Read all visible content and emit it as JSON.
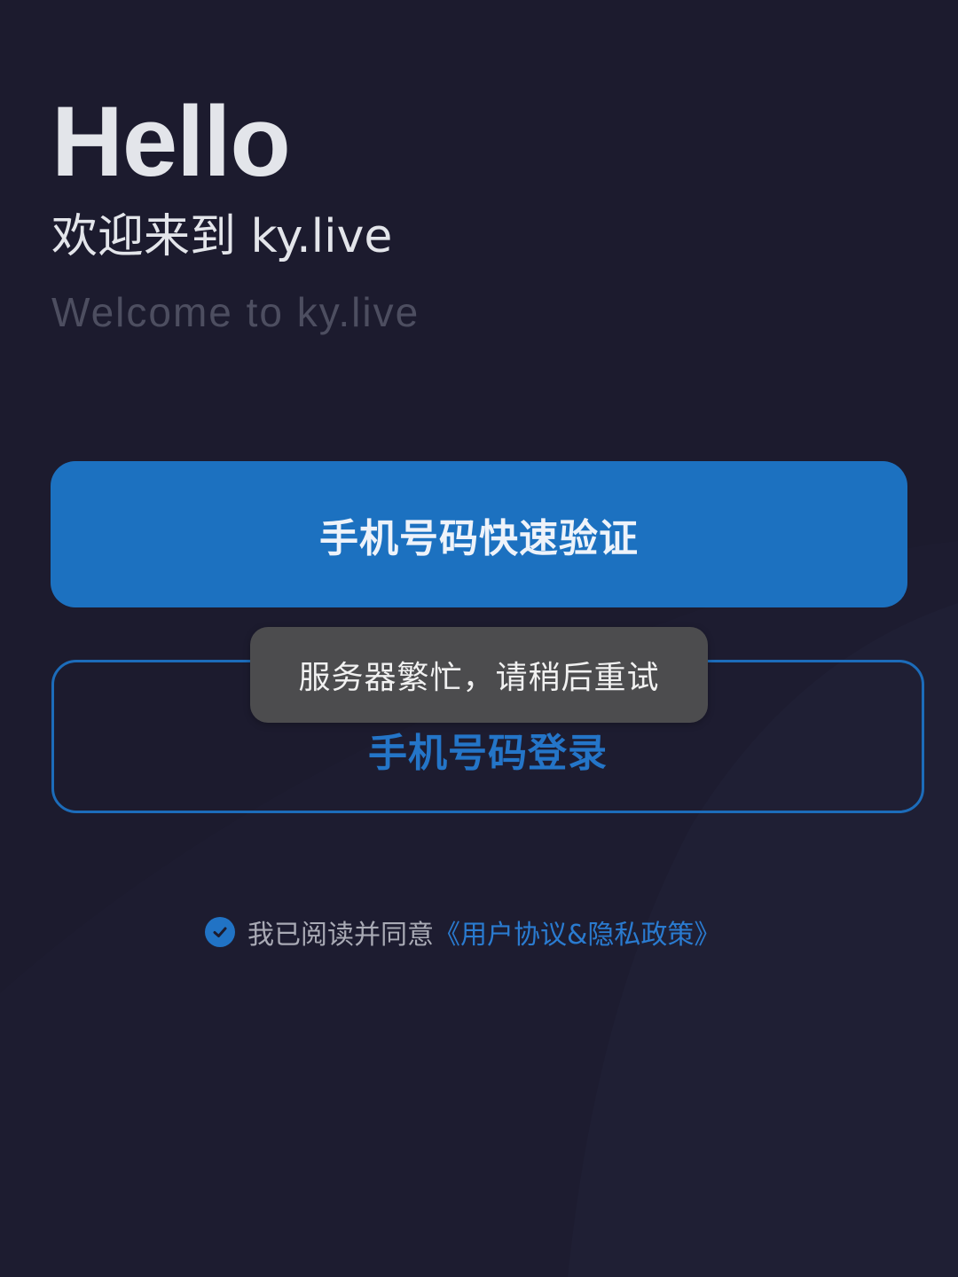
{
  "header": {
    "greeting": "Hello",
    "welcome_cn": "欢迎来到 ky.live",
    "welcome_en": "Welcome to ky.live"
  },
  "buttons": {
    "quick_verify_label": "手机号码快速验证",
    "phone_login_label": "手机号码登录"
  },
  "toast": {
    "message": "服务器繁忙，请稍后重试"
  },
  "agreement": {
    "checked": true,
    "text": "我已阅读并同意",
    "link": "《用户协议&隐私政策》"
  },
  "colors": {
    "background": "#1c1b2e",
    "accent": "#1c71c0",
    "toast_bg": "#4c4c4e"
  },
  "icons": {
    "check": "check-circle-icon"
  }
}
